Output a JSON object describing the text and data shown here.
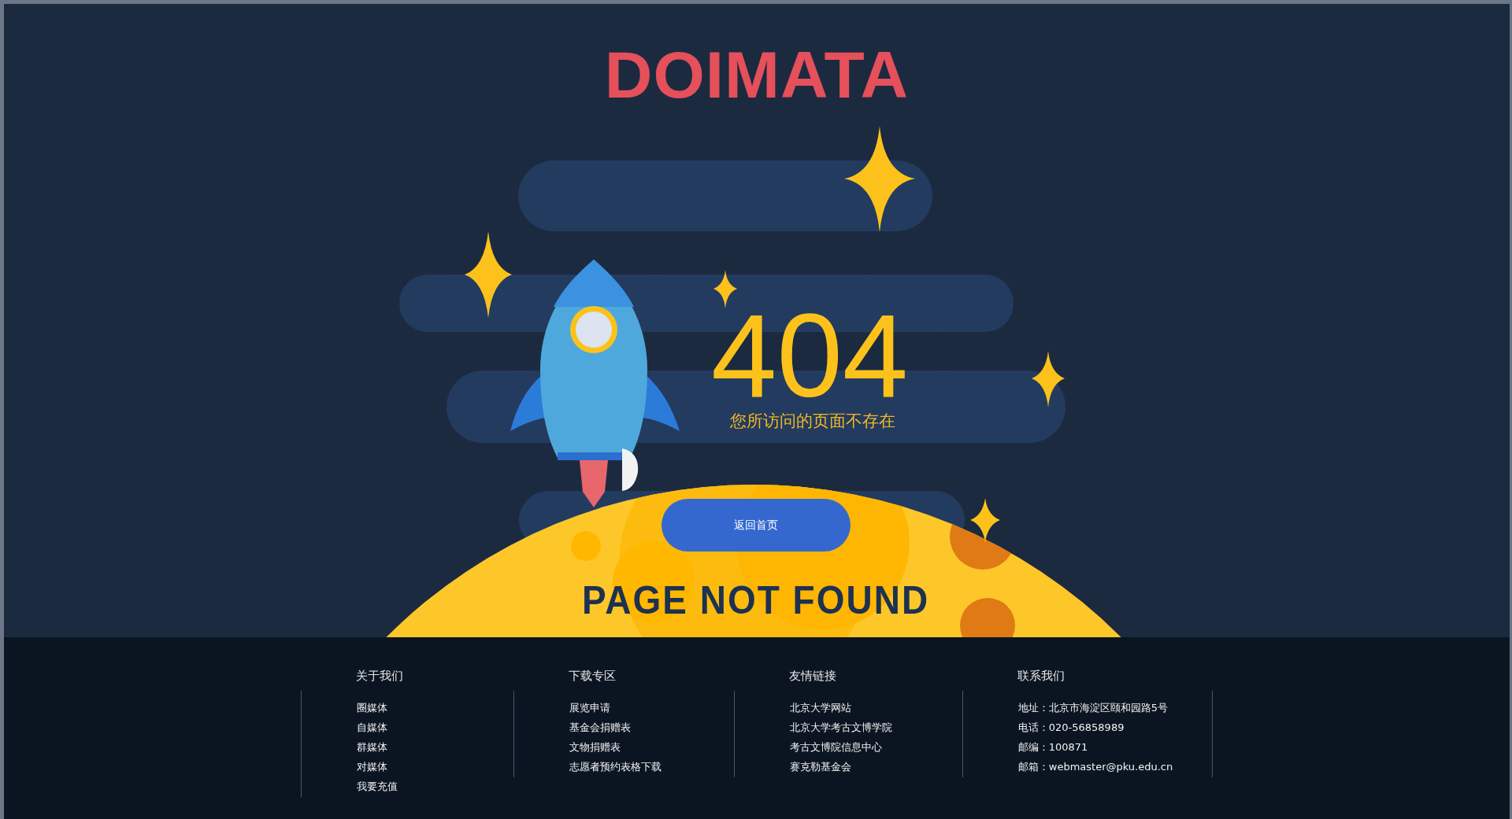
{
  "logo": "DOIMATA",
  "hero": {
    "code": "404",
    "message": "您所访问的页面不存在",
    "button": "返回首页",
    "banner": "PAGE NOT FOUND"
  },
  "footer": {
    "columns": [
      {
        "heading": "关于我们",
        "items": [
          "圈媒体",
          "自媒体",
          "群媒体",
          "对媒体",
          "我要充值"
        ]
      },
      {
        "heading": "下载专区",
        "items": [
          "展览申请",
          "基金会捐赠表",
          "文物捐赠表",
          "志愿者预约表格下载"
        ]
      },
      {
        "heading": "友情链接",
        "items": [
          "北京大学网站",
          "北京大学考古文博学院",
          "考古文博院信息中心",
          "赛克勒基金会"
        ]
      },
      {
        "heading": "联系我们",
        "items": [
          "地址：北京市海淀区颐和园路5号",
          "电话：020-56858989",
          "邮编：100871",
          "邮箱：webmaster@pku.edu.cn"
        ]
      }
    ]
  }
}
